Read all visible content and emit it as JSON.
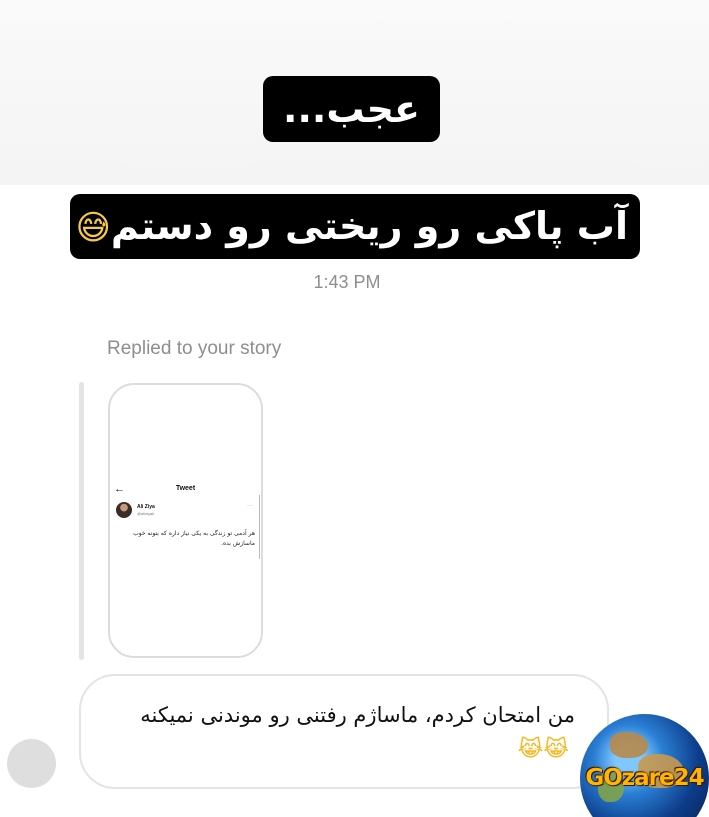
{
  "story_overlay": {
    "caption_1": "عجب...",
    "caption_2": "آب پاکی رو ریختی رو دستم",
    "caption_2_emoji": "😅"
  },
  "timestamp": "1:43 PM",
  "reply": {
    "label": "Replied to your story",
    "tweet": {
      "back_icon": "←",
      "title": "Tweet",
      "author_name": "Ali Ziya",
      "author_handle": "@aliziyak",
      "more_icon": "···",
      "text": "هر آدمی تو زندگی به یکی نیاز داره که بتونه خوب ماسازش بده."
    }
  },
  "message": {
    "text": "من امتحان کردم، ماساژم رفتنی رو  موندنی نمیکنه",
    "emoji": "😹😹"
  },
  "watermark": {
    "text": "GOzare24"
  },
  "colors": {
    "caption_bg": "#000000",
    "secondary_text": "#8e8e8e",
    "bubble_border": "#e4e4e4",
    "watermark_text": "#ffb400"
  }
}
